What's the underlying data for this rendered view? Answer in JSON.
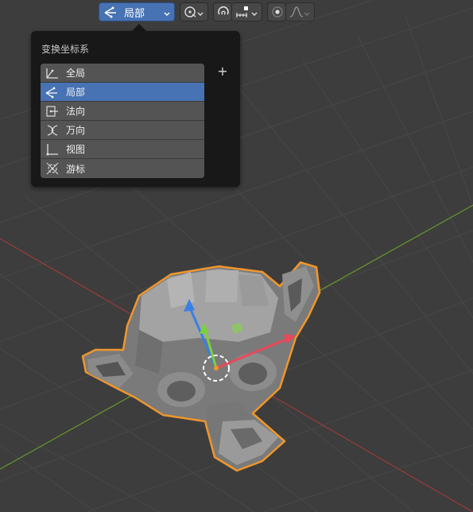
{
  "toolbar": {
    "orientation_label": "局部",
    "orientation_icon": "local-axes-icon",
    "pivot_icon": "pivot-link-icon",
    "snap_icon": "snap-magnet-icon",
    "snap_target_icon": "snap-increment-icon",
    "proportional_icon": "proportional-edit-icon",
    "falloff_icon": "falloff-curve-icon"
  },
  "popup": {
    "title": "变换坐标系",
    "add_icon": "plus-icon",
    "items": [
      {
        "label": "全局",
        "icon": "global-axes-icon",
        "selected": false
      },
      {
        "label": "局部",
        "icon": "local-axes-icon",
        "selected": true
      },
      {
        "label": "法向",
        "icon": "normal-axes-icon",
        "selected": false
      },
      {
        "label": "万向",
        "icon": "gimbal-axes-icon",
        "selected": false
      },
      {
        "label": "视图",
        "icon": "view-axes-icon",
        "selected": false
      },
      {
        "label": "游标",
        "icon": "cursor-axes-icon",
        "selected": false
      }
    ]
  },
  "colors": {
    "accent": "#4772b3",
    "selection_outline": "#f0962b",
    "x_axis": "#9b3a3a",
    "y_axis": "#6a9a2a",
    "grid": "#4a4a4a"
  }
}
